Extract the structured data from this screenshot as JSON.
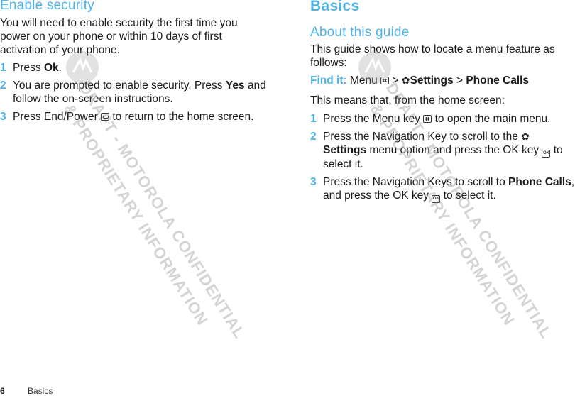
{
  "left": {
    "heading": "Enable security",
    "intro": "You will need to enable security the first time you power on your phone or within 10 days of first activation of your phone.",
    "steps": [
      {
        "num": "1",
        "pre": "Press ",
        "bold": "Ok",
        "post": "."
      },
      {
        "num": "2",
        "pre": "You are prompted to enable security. Press ",
        "bold": "Yes",
        "post": " and follow the on-screen instructions."
      },
      {
        "num": "3",
        "pre": "Press End/Power ",
        "icon": "power-key-icon",
        "post": " to return to the home screen."
      }
    ]
  },
  "right": {
    "title": "Basics",
    "heading": "About this guide",
    "intro": "This guide shows how to locate a menu feature as follows:",
    "find_it": {
      "label": "Find it:",
      "menu": "Menu",
      "sep1": ">",
      "settings": "Settings",
      "sep2": ">",
      "phone_calls": "Phone Calls"
    },
    "means": "This means that, from the home screen:",
    "steps": [
      {
        "num": "1",
        "pre": "Press the Menu key ",
        "post": " to open the main menu."
      },
      {
        "num": "2",
        "pre": "Press the Navigation Key to scroll to the ",
        "bold": "Settings",
        "mid": " menu option and press the OK key ",
        "post": " to select it."
      },
      {
        "num": "3",
        "pre": "Press the Navigation Keys to scroll to ",
        "bold": "Phone Calls",
        "mid": ", and press the OK key ",
        "post": " to select it."
      }
    ]
  },
  "icons": {
    "gear": "✿",
    "ok_key": "OK"
  },
  "footer": {
    "page_number": "6",
    "section": "Basics"
  },
  "watermark": {
    "line1": "DRAFT - MOTOROLA CONFIDENTIAL",
    "line2": "& PROPRIETARY INFORMATION"
  },
  "colors": {
    "accent": "#4eb3e6",
    "text": "#1a1a1a"
  }
}
